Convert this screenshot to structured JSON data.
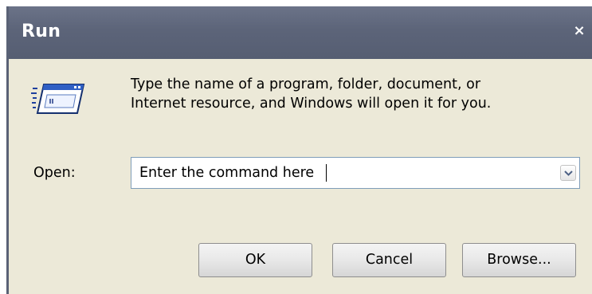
{
  "window": {
    "title": "Run",
    "close_glyph": "×"
  },
  "dialog": {
    "icon": "run-program-icon",
    "description_line1": "Type the name of a program, folder, document, or",
    "description_line2": "Internet resource, and Windows will open it for you.",
    "open_label": "Open:",
    "open_value": "Enter the command here"
  },
  "buttons": {
    "ok": "OK",
    "cancel": "Cancel",
    "browse": "Browse..."
  },
  "colors": {
    "titlebar": "#5c6479",
    "dialog_bg": "#ece9d8",
    "input_border": "#7f9db9"
  }
}
